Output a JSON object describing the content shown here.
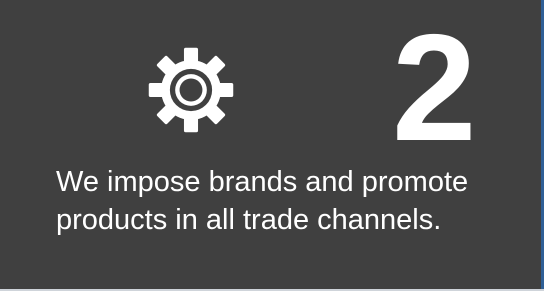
{
  "card": {
    "icon": "gear-icon",
    "number": "2",
    "text": "We impose brands and promote products in all trade channels.",
    "colors": {
      "background": "#404040",
      "foreground": "#ffffff"
    }
  }
}
